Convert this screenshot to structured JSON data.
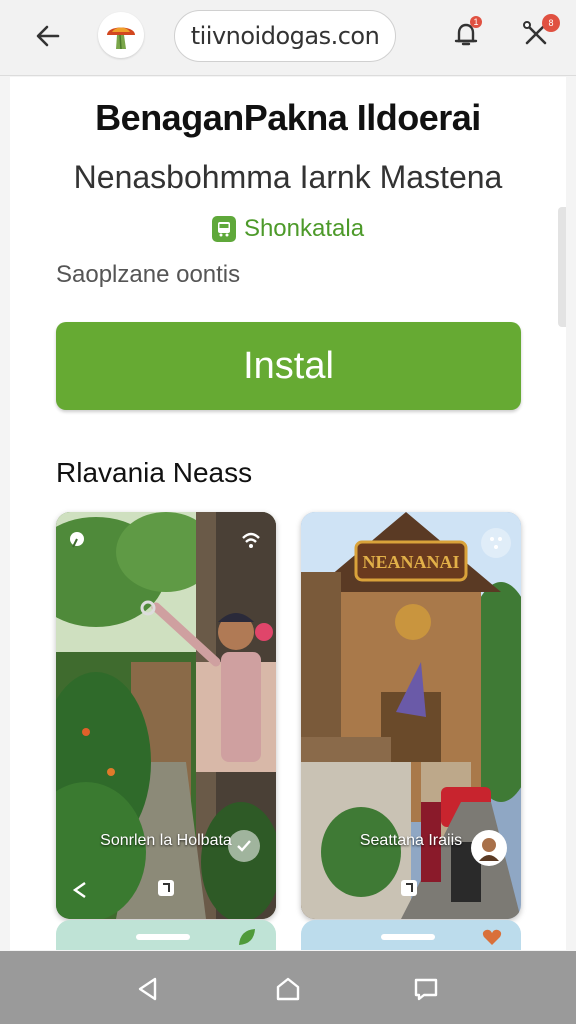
{
  "browser": {
    "url": "tiivnoidogas.con",
    "back_icon": "arrow-left-icon",
    "logo_icon": "mushroom-logo-icon",
    "bell_icon": "bell-icon",
    "tools_icon": "tools-icon",
    "bell_badge": "1",
    "tools_badge": "8"
  },
  "app": {
    "title": "BenaganPakna Ildoerai",
    "subtitle": "Nenasbohmma Iarnk Mastena",
    "developer": "Shonkatala",
    "developer_icon": "bus-icon",
    "meta": "Saoplzane oontis",
    "install_label": "Instal",
    "accent_color": "#66aa33"
  },
  "section": {
    "title": "Rlavania Neass"
  },
  "screenshots": [
    {
      "caption": "Sonrlen la Holbata",
      "top_icon": "pin-icon",
      "top_right_icon": "wifi-icon",
      "corner_icon": "check-icon",
      "bottom_left_icon": "share-icon",
      "bottom_center_icon": "crop-icon"
    },
    {
      "caption": "Seattana Iraiis",
      "sign_text": "NEANANAI",
      "top_right_icon": "expand-icon",
      "corner_icon": "avatar-icon",
      "bottom_center_icon": "crop-icon"
    }
  ],
  "system_nav": {
    "back_icon": "triangle-back-icon",
    "home_icon": "home-icon",
    "recents_icon": "recents-icon"
  }
}
